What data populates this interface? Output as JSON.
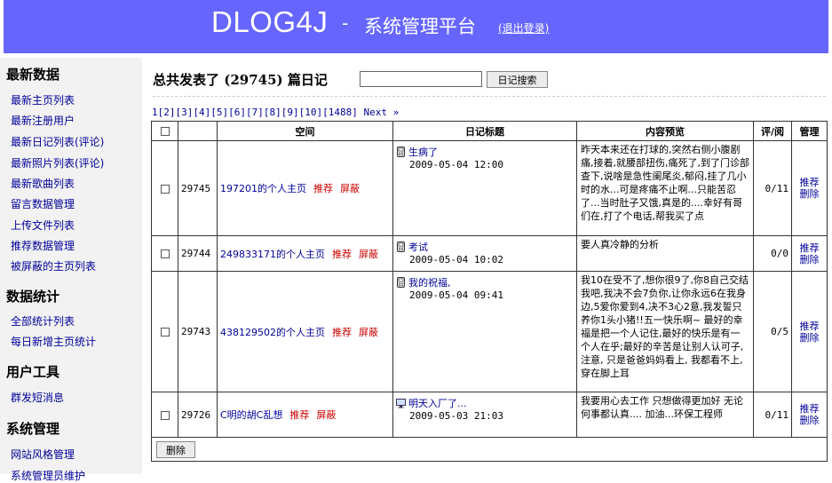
{
  "header": {
    "brand": "DLOG4J",
    "dash": "-",
    "subtitle": "系统管理平台",
    "logout": "(退出登录)"
  },
  "sidebar": {
    "sections": [
      {
        "title": "最新数据",
        "items": [
          "最新主页列表",
          "最新注册用户",
          "最新日记列表(评论)",
          "最新照片列表(评论)",
          "最新歌曲列表",
          "留言数据管理",
          "上传文件列表",
          "推荐数据管理",
          "被屏蔽的主页列表"
        ]
      },
      {
        "title": "数据统计",
        "items": [
          "全部统计列表",
          "每日新增主页统计"
        ]
      },
      {
        "title": "用户工具",
        "items": [
          "群发短消息"
        ]
      },
      {
        "title": "系统管理",
        "items": [
          "网站风格管理",
          "系统管理员维护"
        ]
      }
    ]
  },
  "main": {
    "total_text": "总共发表了 (29745) 篇日记",
    "search_value": "",
    "search_button": "日记搜索",
    "pager": [
      "1",
      "[2]",
      "[3]",
      "[4]",
      "[5]",
      "[6]",
      "[7]",
      "[8]",
      "[9]",
      "[10]",
      "[1488]",
      "Next »"
    ],
    "table": {
      "headers": [
        "",
        "",
        "空间",
        "日记标题",
        "内容预览",
        "评/阅",
        "管理"
      ],
      "rows": [
        {
          "id": "29745",
          "space": "197201的个人主页",
          "recommend": "推荐",
          "block": "屏蔽",
          "icon": "phone-icon",
          "title": "生病了",
          "time": "2009-05-04 12:00",
          "preview": "昨天本来还在打球的,突然右侧小腹剧痛,接着,就腰部扭伤,痛死了,到了门诊部查下,说啥是急性阑尾炎,郁闷,挂了几小时的水...可是疼痛不止啊...只能苦忍了...当时肚子又饿,真是的....幸好有哥们在,打了个电话,帮我买了点",
          "ratio": "0/11",
          "m1": "推荐",
          "m2": "删除"
        },
        {
          "id": "29744",
          "space": "249833171的个人主页",
          "recommend": "推荐",
          "block": "屏蔽",
          "icon": "phone-icon",
          "title": "考试",
          "time": "2009-05-04 10:02",
          "preview": "要人真冷静的分析",
          "ratio": "0/0",
          "m1": "推荐",
          "m2": "删除"
        },
        {
          "id": "29743",
          "space": "438129502的个人主页",
          "recommend": "推荐",
          "block": "屏蔽",
          "icon": "phone-icon",
          "title": "我的祝福,",
          "time": "2009-05-04 09:41",
          "preview": "我10在受不了,想你很9了,你8自己交结我吧,我决不会7负你,让你永远6在我身边,5爱你爱到4,决不3心2意,我发誓只养你1头小猪!!五一快乐啊~ 最好的幸福是把一个人记住,最好的快乐是有一个人在乎;最好的辛苦是让别人认可子, 注意, 只是爸爸妈妈看上, 我都看不上, 穿在脚上耳",
          "ratio": "0/5",
          "m1": "推荐",
          "m2": "删除"
        },
        {
          "id": "29726",
          "space": "C明的胡C乱想",
          "recommend": "推荐",
          "block": "屏蔽",
          "icon": "monitor-icon",
          "title": "明天入厂了...",
          "time": "2009-05-03 21:03",
          "preview": "我要用心去工作 只想做得更加好 无论何事都认真.... 加油...环保工程师",
          "ratio": "0/11",
          "m1": "推荐",
          "m2": "删除"
        }
      ],
      "delete_button": "删除"
    }
  }
}
